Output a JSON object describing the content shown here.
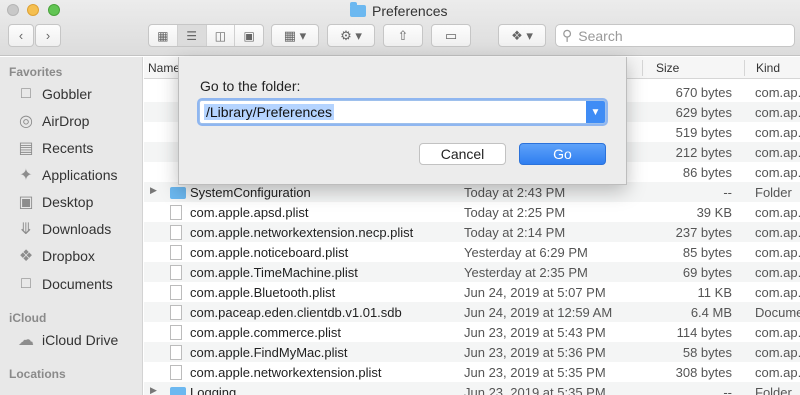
{
  "window": {
    "title": "Preferences"
  },
  "toolbar": {
    "search_placeholder": "Search"
  },
  "sidebar": {
    "sections": [
      {
        "label": "Favorites",
        "items": [
          {
            "label": "Gobbler",
            "icon": "folder-icon"
          },
          {
            "label": "AirDrop",
            "icon": "airdrop-icon"
          },
          {
            "label": "Recents",
            "icon": "recents-icon"
          },
          {
            "label": "Applications",
            "icon": "applications-icon"
          },
          {
            "label": "Desktop",
            "icon": "desktop-icon"
          },
          {
            "label": "Downloads",
            "icon": "downloads-icon"
          },
          {
            "label": "Dropbox",
            "icon": "dropbox-icon"
          },
          {
            "label": "Documents",
            "icon": "documents-icon"
          }
        ]
      },
      {
        "label": "iCloud",
        "items": [
          {
            "label": "iCloud Drive",
            "icon": "cloud-icon"
          }
        ]
      },
      {
        "label": "Locations",
        "items": []
      }
    ]
  },
  "table": {
    "columns": {
      "name": "Name",
      "size": "Size",
      "kind": "Kind"
    },
    "rows": [
      {
        "name": "",
        "date": "",
        "size": "670 bytes",
        "kind": "com.ap..."
      },
      {
        "name": "",
        "date": "",
        "size": "629 bytes",
        "kind": "com.ap..."
      },
      {
        "name": "",
        "date": "",
        "size": "519 bytes",
        "kind": "com.ap..."
      },
      {
        "name": "",
        "date": "",
        "size": "212 bytes",
        "kind": "com.ap..."
      },
      {
        "name": "",
        "date": "",
        "size": "86 bytes",
        "kind": "com.ap..."
      },
      {
        "name": "SystemConfiguration",
        "date": "Today at 2:43 PM",
        "size": "--",
        "kind": "Folder",
        "folder": true
      },
      {
        "name": "com.apple.apsd.plist",
        "date": "Today at 2:25 PM",
        "size": "39 KB",
        "kind": "com.ap..."
      },
      {
        "name": "com.apple.networkextension.necp.plist",
        "date": "Today at 2:14 PM",
        "size": "237 bytes",
        "kind": "com.ap..."
      },
      {
        "name": "com.apple.noticeboard.plist",
        "date": "Yesterday at 6:29 PM",
        "size": "85 bytes",
        "kind": "com.ap..."
      },
      {
        "name": "com.apple.TimeMachine.plist",
        "date": "Yesterday at 2:35 PM",
        "size": "69 bytes",
        "kind": "com.ap..."
      },
      {
        "name": "com.apple.Bluetooth.plist",
        "date": "Jun 24, 2019 at 5:07 PM",
        "size": "11 KB",
        "kind": "com.ap..."
      },
      {
        "name": "com.paceap.eden.clientdb.v1.01.sdb",
        "date": "Jun 24, 2019 at 12:59 AM",
        "size": "6.4 MB",
        "kind": "Docume..."
      },
      {
        "name": "com.apple.commerce.plist",
        "date": "Jun 23, 2019 at 5:43 PM",
        "size": "114 bytes",
        "kind": "com.ap..."
      },
      {
        "name": "com.apple.FindMyMac.plist",
        "date": "Jun 23, 2019 at 5:36 PM",
        "size": "58 bytes",
        "kind": "com.ap..."
      },
      {
        "name": "com.apple.networkextension.plist",
        "date": "Jun 23, 2019 at 5:35 PM",
        "size": "308 bytes",
        "kind": "com.ap..."
      },
      {
        "name": "Logging",
        "date": "Jun 23, 2019 at 5:35 PM",
        "size": "--",
        "kind": "Folder",
        "folder": true
      }
    ]
  },
  "dialog": {
    "label": "Go to the folder:",
    "path_value": "/Library/Preferences",
    "cancel_label": "Cancel",
    "go_label": "Go"
  }
}
